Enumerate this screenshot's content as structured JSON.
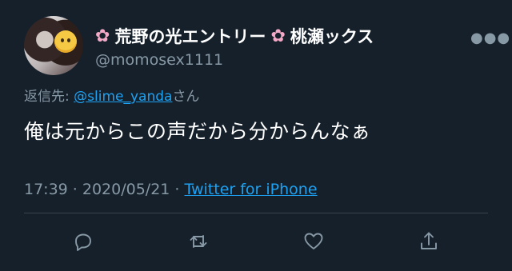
{
  "tweet": {
    "author_name": "荒野の光エントリー🌸桃瀬ックス",
    "name_parts": [
      "荒野の光エントリー",
      "桃瀬ックス"
    ],
    "handle": "@momosex1111",
    "reply_prefix": "返信先: ",
    "reply_to": "@slime_yanda",
    "reply_suffix": "さん",
    "text": "俺は元からこの声だから分からんなぁ",
    "time": "17:39 · 2020/05/21 · ",
    "source": "Twitter for iPhone"
  },
  "icons": {
    "more": "more-icon",
    "avatar": "avatar",
    "reply": "reply-icon",
    "retweet": "retweet-icon",
    "like": "like-icon",
    "share": "share-icon",
    "blossom": "cherry-blossom-icon"
  },
  "colors": {
    "background": "#15202b",
    "text": "#ffffff",
    "muted": "#8899a6",
    "link": "#1da1f2",
    "divider": "#38444d",
    "blossom": "#f4a9c6"
  }
}
